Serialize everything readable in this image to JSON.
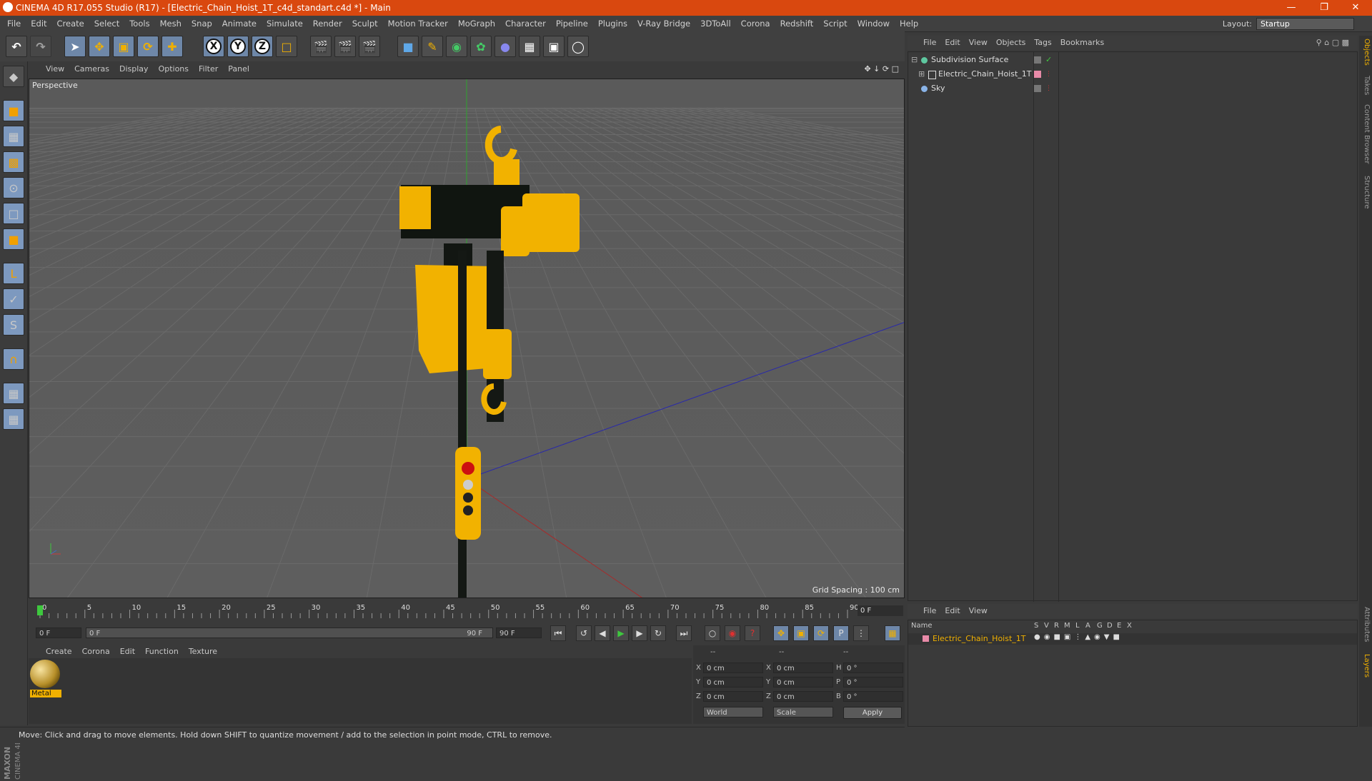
{
  "window": {
    "title": "CINEMA 4D R17.055 Studio (R17) - [Electric_Chain_Hoist_1T_c4d_standart.c4d *] - Main"
  },
  "menu": [
    "File",
    "Edit",
    "Create",
    "Select",
    "Tools",
    "Mesh",
    "Snap",
    "Animate",
    "Simulate",
    "Render",
    "Sculpt",
    "Motion Tracker",
    "MoGraph",
    "Character",
    "Pipeline",
    "Plugins",
    "V-Ray Bridge",
    "3DToAll",
    "Corona",
    "Redshift",
    "Script",
    "Window",
    "Help"
  ],
  "layout": {
    "label": "Layout:",
    "value": "Startup"
  },
  "viewport": {
    "menu": [
      "View",
      "Cameras",
      "Display",
      "Options",
      "Filter",
      "Panel"
    ],
    "camera_label": "Perspective",
    "grid_spacing": "Grid Spacing : 100 cm"
  },
  "timeline": {
    "ticks": [
      "0",
      "5",
      "10",
      "15",
      "20",
      "25",
      "30",
      "35",
      "40",
      "45",
      "50",
      "55",
      "60",
      "65",
      "70",
      "75",
      "80",
      "85",
      "90"
    ],
    "current_frame": "0 F",
    "start_field": "0 F",
    "range_start": "0 F",
    "range_end": "90 F",
    "end_field": "90 F"
  },
  "material_manager": {
    "menu": [
      "Create",
      "Corona",
      "Edit",
      "Function",
      "Texture"
    ],
    "materials": [
      {
        "name": "Metal"
      }
    ]
  },
  "coordinates": {
    "header": [
      "--",
      "--",
      "--"
    ],
    "rows": [
      {
        "axis": "X",
        "pos": "0 cm",
        "size_axis": "X",
        "size": "0 cm",
        "rot_axis": "H",
        "rot": "0 °"
      },
      {
        "axis": "Y",
        "pos": "0 cm",
        "size_axis": "Y",
        "size": "0 cm",
        "rot_axis": "P",
        "rot": "0 °"
      },
      {
        "axis": "Z",
        "pos": "0 cm",
        "size_axis": "Z",
        "size": "0 cm",
        "rot_axis": "B",
        "rot": "0 °"
      }
    ],
    "mode1": "World",
    "mode2": "Scale",
    "apply": "Apply"
  },
  "status": "Move: Click and drag to move elements. Hold down SHIFT to quantize movement / add to the selection in point mode, CTRL to remove.",
  "object_manager": {
    "menu": [
      "File",
      "Edit",
      "View",
      "Objects",
      "Tags",
      "Bookmarks"
    ],
    "objects": [
      {
        "name": "Subdivision Surface",
        "color": "#5ec8a0"
      },
      {
        "name": "Electric_Chain_Hoist_1T",
        "color": "#e88aa8"
      },
      {
        "name": "Sky",
        "color": "#8ab4e8"
      }
    ]
  },
  "layer_manager": {
    "menu": [
      "File",
      "Edit",
      "View"
    ],
    "columns": [
      "Name",
      "S",
      "V",
      "R",
      "M",
      "L",
      "A",
      "G",
      "D",
      "E",
      "X"
    ],
    "layers": [
      {
        "name": "Electric_Chain_Hoist_1T",
        "color": "#e88aa8"
      }
    ]
  },
  "side_tabs": [
    "Objects",
    "Takes",
    "Content Browser",
    "Structure"
  ],
  "side_tabs_bottom": [
    "Attributes",
    "Layers"
  ],
  "brand": "MAXON CINEMA 4D",
  "colors": {
    "titlebar": "#d9480f",
    "accent": "#f0b000",
    "hoist_yellow": "#f2b200"
  }
}
